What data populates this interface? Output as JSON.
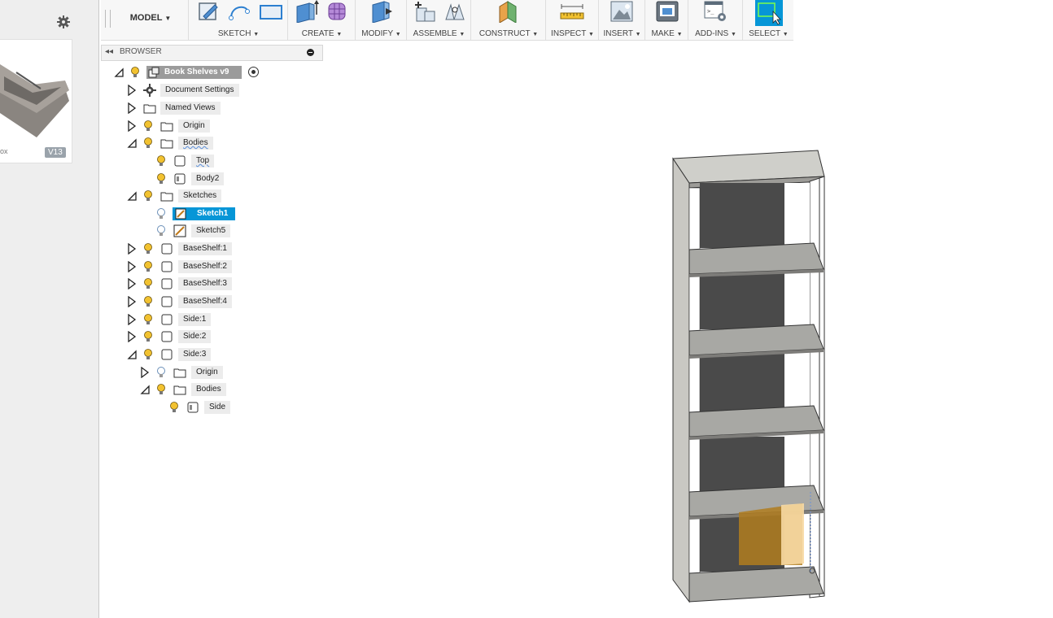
{
  "left_panel": {
    "thumbnail_label": "ox",
    "thumbnail_version": "V13"
  },
  "toolbar": {
    "workspace": "MODEL",
    "groups": [
      {
        "label": "SKETCH"
      },
      {
        "label": "CREATE"
      },
      {
        "label": "MODIFY"
      },
      {
        "label": "ASSEMBLE"
      },
      {
        "label": "CONSTRUCT"
      },
      {
        "label": "INSPECT"
      },
      {
        "label": "INSERT"
      },
      {
        "label": "MAKE"
      },
      {
        "label": "ADD-INS"
      },
      {
        "label": "SELECT"
      }
    ]
  },
  "browser": {
    "title": "BROWSER",
    "root": "Book Shelves v9",
    "items": [
      "Document Settings",
      "Named Views",
      "Origin",
      "Bodies",
      "Top",
      "Body2",
      "Sketches",
      "Sketch1",
      "Sketch5",
      "BaseShelf:1",
      "BaseShelf:2",
      "BaseShelf:3",
      "BaseShelf:4",
      "Side:1",
      "Side:2",
      "Side:3",
      "Origin",
      "Bodies",
      "Side"
    ]
  },
  "colors": {
    "selection": "#0696d7",
    "bulb": "#f2c230",
    "bulb_off": "#a9c6e8"
  }
}
